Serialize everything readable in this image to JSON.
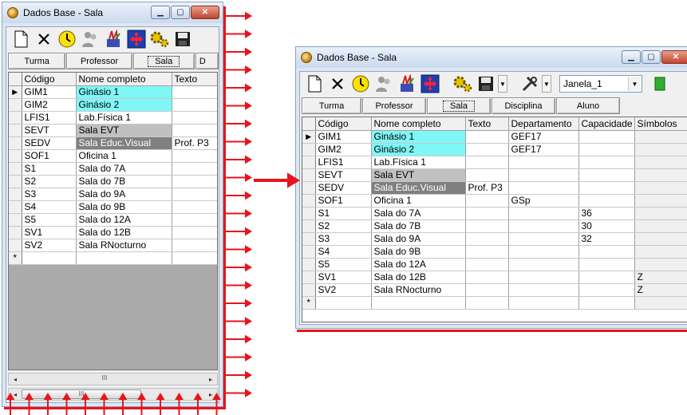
{
  "window_title": "Dados Base - Sala",
  "toolbar": {
    "icons": [
      "new-document-icon",
      "delete-icon",
      "clock-icon",
      "gray-people-icon",
      "color-pens-icon",
      "move-arrows-icon",
      "gears-icon",
      "save-icon",
      "tools-icon",
      "green-sheet-icon"
    ],
    "window_combo_value": "Janela_1"
  },
  "tabs": [
    "Turma",
    "Professor",
    "Sala",
    "Disciplina",
    "Aluno"
  ],
  "left_tab_overflow": "D",
  "active_tab": "Sala",
  "columns": [
    "Código",
    "Nome completo",
    "Texto",
    "Departamento",
    "Capacidade",
    "Símbolos"
  ],
  "rows": [
    {
      "code": "GIM1",
      "name": "Ginásio 1",
      "text": "",
      "dept": "GEF17",
      "cap": "",
      "sym": "",
      "color": "cyan",
      "current": true
    },
    {
      "code": "GIM2",
      "name": "Ginásio 2",
      "text": "",
      "dept": "GEF17",
      "cap": "",
      "sym": "",
      "color": "cyan",
      "current": false
    },
    {
      "code": "LFIS1",
      "name": "Lab.Física 1",
      "text": "",
      "dept": "",
      "cap": "",
      "sym": "",
      "color": "",
      "current": false
    },
    {
      "code": "SEVT",
      "name": "Sala EVT",
      "text": "",
      "dept": "",
      "cap": "",
      "sym": "",
      "color": "lgray",
      "current": false
    },
    {
      "code": "SEDV",
      "name": "Sala Educ.Visual",
      "text": "Prof. P3",
      "dept": "",
      "cap": "",
      "sym": "",
      "color": "dgray",
      "current": false
    },
    {
      "code": "SOF1",
      "name": "Oficina 1",
      "text": "",
      "dept": "GSp",
      "cap": "",
      "sym": "",
      "color": "",
      "current": false
    },
    {
      "code": "S1",
      "name": "Sala do 7A",
      "text": "",
      "dept": "",
      "cap": "36",
      "sym": "",
      "color": "",
      "current": false
    },
    {
      "code": "S2",
      "name": "Sala do 7B",
      "text": "",
      "dept": "",
      "cap": "30",
      "sym": "",
      "color": "",
      "current": false
    },
    {
      "code": "S3",
      "name": "Sala do 9A",
      "text": "",
      "dept": "",
      "cap": "32",
      "sym": "",
      "color": "",
      "current": false
    },
    {
      "code": "S4",
      "name": "Sala do 9B",
      "text": "",
      "dept": "",
      "cap": "",
      "sym": "",
      "color": "",
      "current": false
    },
    {
      "code": "S5",
      "name": "Sala do 12A",
      "text": "",
      "dept": "",
      "cap": "",
      "sym": "",
      "color": "",
      "current": false
    },
    {
      "code": "SV1",
      "name": "Sala do 12B",
      "text": "",
      "dept": "",
      "cap": "",
      "sym": "Z",
      "color": "",
      "current": false
    },
    {
      "code": "SV2",
      "name": "Sala RNocturno",
      "text": "",
      "dept": "",
      "cap": "",
      "sym": "Z",
      "color": "",
      "current": false
    }
  ],
  "new_row_marker": "*",
  "current_row_marker": "▶",
  "scroll": {
    "left_glyph": "◂",
    "right_glyph": "▸",
    "thumb_glyph": "III"
  },
  "annotation": {
    "color": "#e8141c"
  },
  "colors": {
    "cyan": "#7ff7f7",
    "light_gray": "#c0c0c0",
    "dark_gray": "#808080"
  }
}
